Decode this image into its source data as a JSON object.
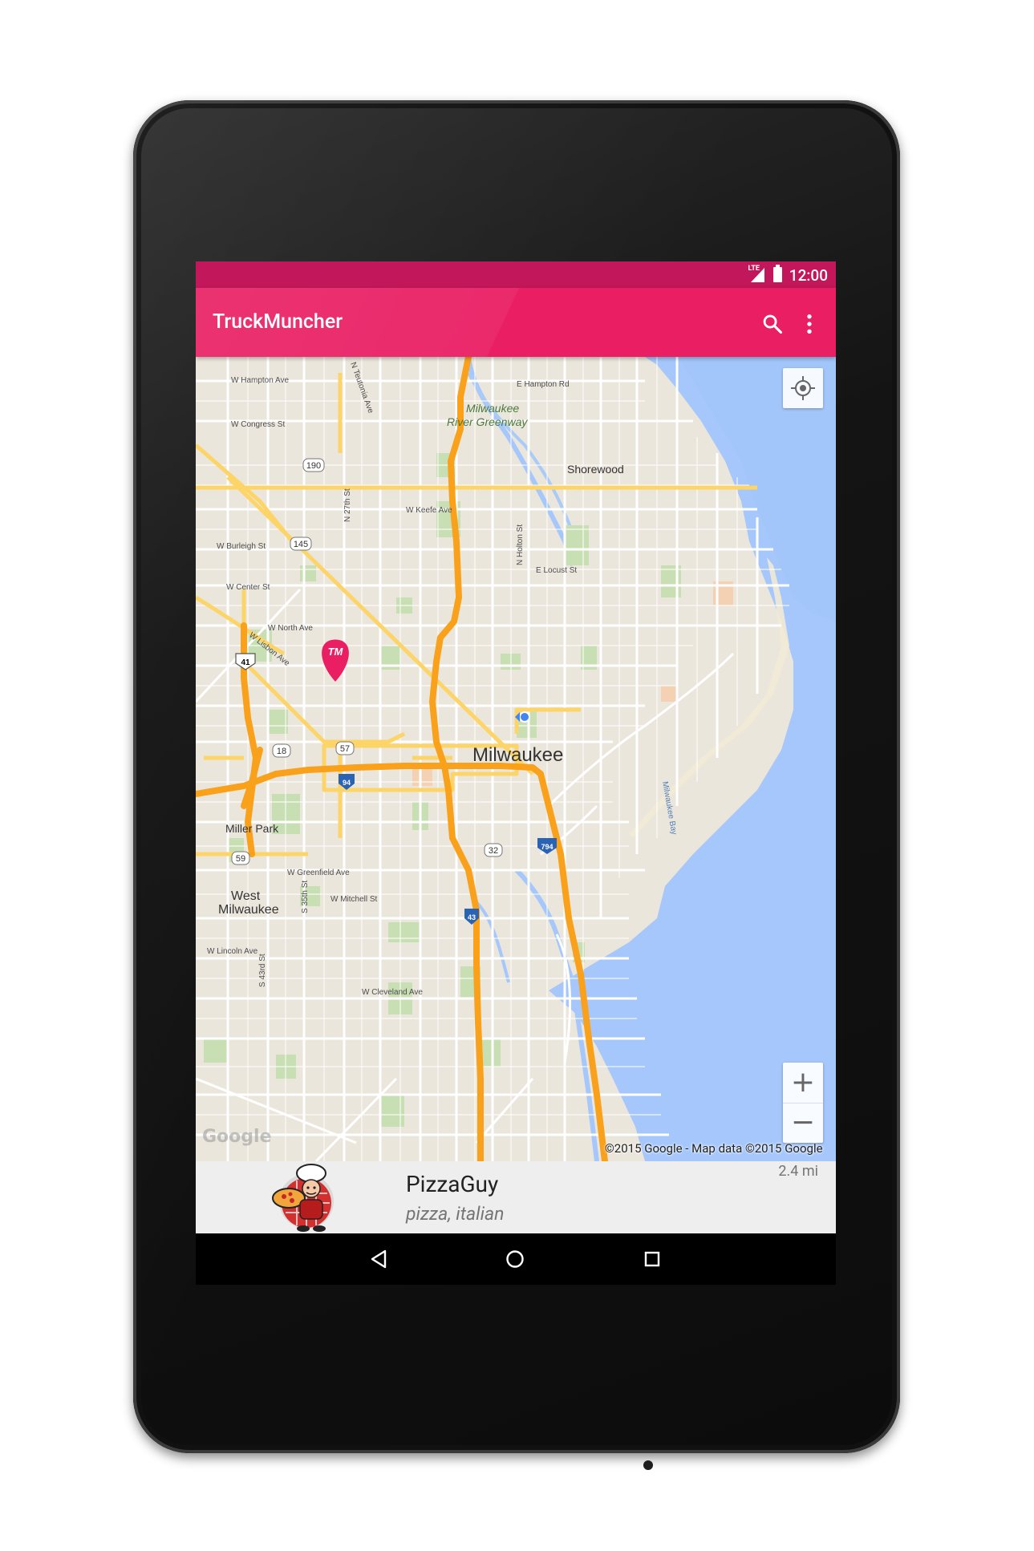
{
  "status_bar": {
    "time": "12:00",
    "network": "LTE",
    "color": "#c2185b"
  },
  "app_bar": {
    "title": "TruckMuncher",
    "color": "#e91e63",
    "actions": [
      "search-icon",
      "overflow-menu-icon"
    ]
  },
  "map": {
    "accent_marker_label": "TM",
    "labels": {
      "city": "Milwaukee",
      "shorewood": "Shorewood",
      "greenway_1": "Milwaukee",
      "greenway_2": "River Greenway",
      "miller_park": "Miller Park",
      "west_milwaukee_1": "West",
      "west_milwaukee_2": "Milwaukee",
      "bay": "Milwaukee Bay",
      "w_hampton": "W Hampton Ave",
      "e_hampton": "E Hampton Rd",
      "w_congress": "W Congress St",
      "w_keefe": "W Keefe Ave",
      "w_burleigh": "W Burleigh St",
      "w_center": "W Center St",
      "w_north": "W North Ave",
      "w_lisbon": "W Lisbon Ave",
      "e_locust": "E Locust St",
      "n_teutonia": "N Teutonia Ave",
      "n_27th": "N 27th St",
      "n_holton": "N Holton St",
      "w_greenfield": "W Greenfield Ave",
      "w_mitchell": "W Mitchell St",
      "s_35th": "S 35th St",
      "w_lincoln": "W Lincoln Ave",
      "s_43rd": "S 43rd St",
      "w_cleveland": "W Cleveland Ave"
    },
    "shields": {
      "r190": "190",
      "r145": "145",
      "r41": "41",
      "r57": "57",
      "r18": "18",
      "r94": "94",
      "r59": "59",
      "r32": "32",
      "r794": "794",
      "r43": "43"
    },
    "attribution": "©2015 Google - Map data ©2015 Google",
    "google_logo": "Google",
    "zoom_in": "+",
    "zoom_out": "−"
  },
  "truck": {
    "name": "PizzaGuy",
    "tags": "pizza, italian",
    "distance": "2.4 mi"
  }
}
